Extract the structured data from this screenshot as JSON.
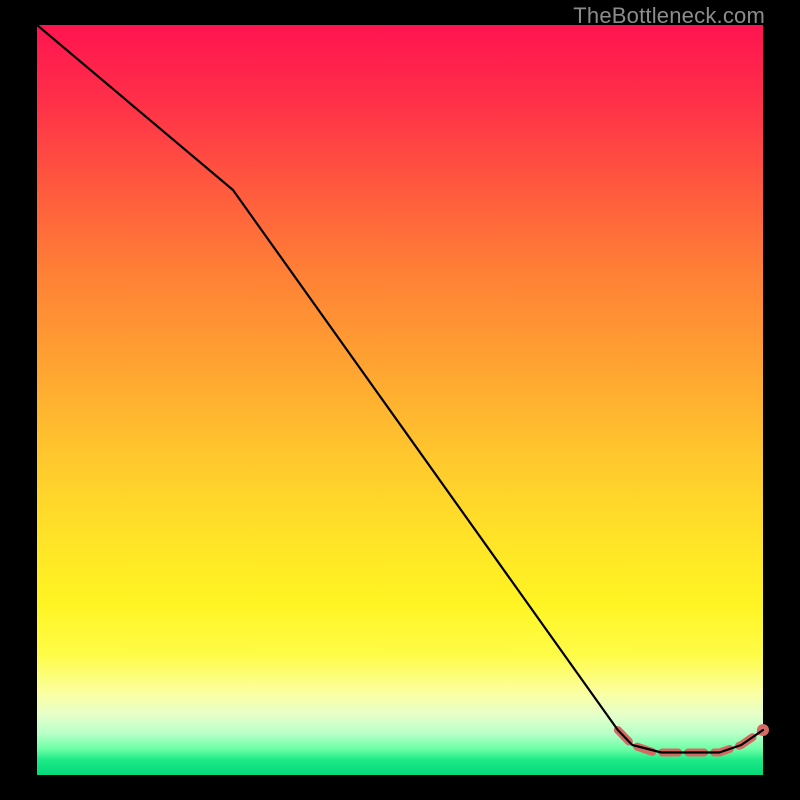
{
  "watermark": "TheBottleneck.com",
  "colors": {
    "curve": "#000000",
    "marker": "#d36b63",
    "background_black": "#000000"
  },
  "chart_data": {
    "type": "line",
    "title": "",
    "xlabel": "",
    "ylabel": "",
    "xlim": [
      0,
      100
    ],
    "ylim": [
      0,
      100
    ],
    "curve": {
      "x": [
        0,
        27,
        80,
        82,
        86,
        90,
        94,
        97,
        100
      ],
      "y": [
        100,
        78,
        6,
        4,
        3,
        3,
        3,
        4,
        6
      ]
    },
    "bottom_marker": {
      "x": [
        80,
        82,
        85,
        88,
        91,
        94,
        97,
        100
      ],
      "y": [
        6,
        4,
        3,
        3,
        3,
        3,
        4,
        6
      ],
      "end_dot": {
        "x": 100,
        "y": 6
      }
    }
  }
}
